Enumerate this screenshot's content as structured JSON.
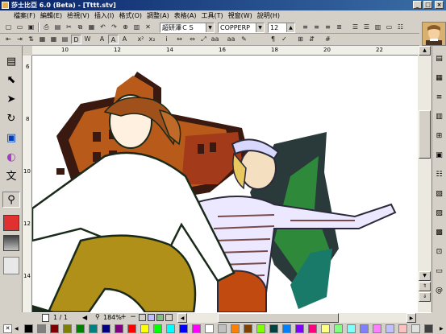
{
  "window": {
    "title": "莎士比亞 6.0 (Beta) - [Tttt.stv]"
  },
  "menu": [
    "檔案(F)",
    "編輯(E)",
    "檢視(V)",
    "插入(I)",
    "格式(O)",
    "調整(A)",
    "表格(A)",
    "工具(T)",
    "視窗(W)",
    "說明(H)"
  ],
  "toolbar": {
    "font_name": "超研澤ＣＳ",
    "font_latin": "COPPERP",
    "font_size": "12"
  },
  "ruler": {
    "h_ticks": [
      "10",
      "12",
      "14",
      "16",
      "18",
      "20",
      "22"
    ],
    "v_ticks": [
      "6",
      "8",
      "10",
      "12",
      "14"
    ]
  },
  "status": {
    "page": "1 / 1",
    "zoom": "184%"
  },
  "colors": {
    "accent": "#0a246a",
    "swatches": [
      "#000000",
      "#808080",
      "#800000",
      "#808000",
      "#008000",
      "#008080",
      "#000080",
      "#800080",
      "#ff0000",
      "#ffff00",
      "#00ff00",
      "#00ffff",
      "#0000ff",
      "#ff00ff",
      "#ffffff",
      "#c0c0c0",
      "#ff8000",
      "#804000",
      "#80ff00",
      "#004040",
      "#0080ff",
      "#8000ff",
      "#ff0080",
      "#ffff80",
      "#80ff80",
      "#80ffff",
      "#8080ff",
      "#ff80ff",
      "#c0c0ff",
      "#ffc0c0",
      "#e0e0e0",
      "#404040"
    ]
  }
}
